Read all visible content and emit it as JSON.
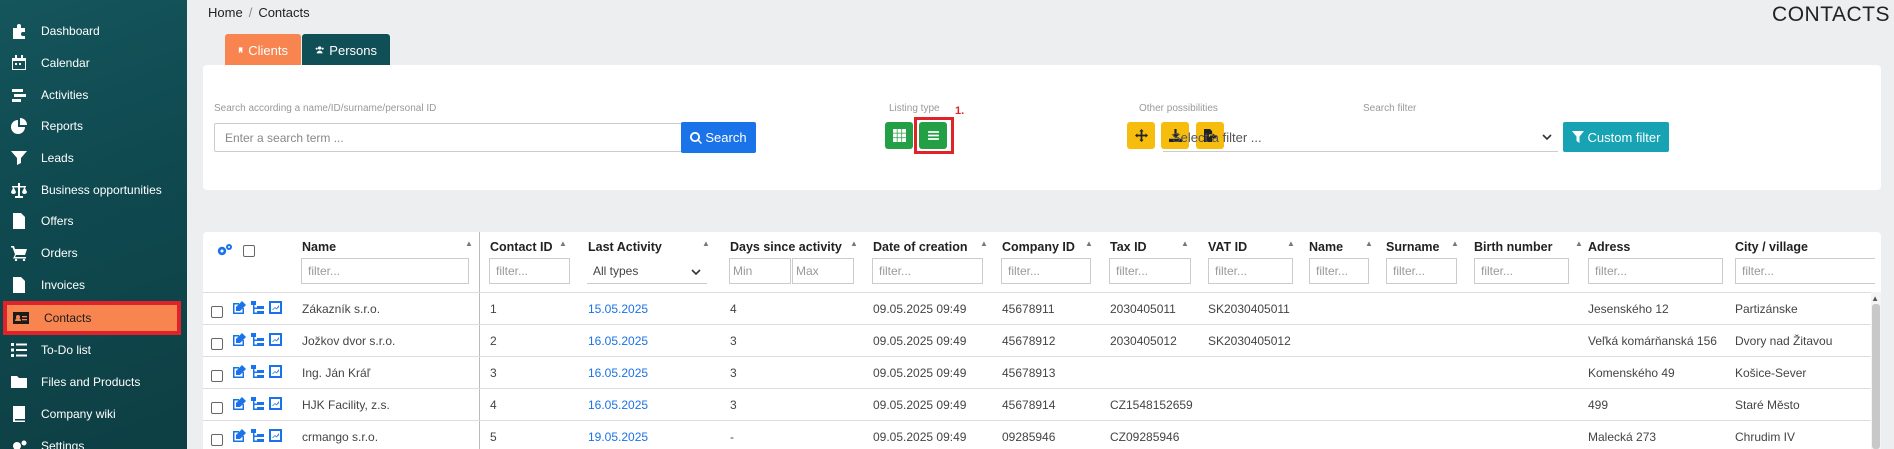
{
  "sidebar": {
    "items": [
      {
        "label": "Dashboard",
        "icon": "puzzle-icon"
      },
      {
        "label": "Calendar",
        "icon": "calendar-icon"
      },
      {
        "label": "Activities",
        "icon": "activities-icon"
      },
      {
        "label": "Reports",
        "icon": "pie-chart-icon"
      },
      {
        "label": "Leads",
        "icon": "leads-icon"
      },
      {
        "label": "Business opportunities",
        "icon": "scale-icon"
      },
      {
        "label": "Offers",
        "icon": "document-icon"
      },
      {
        "label": "Orders",
        "icon": "cart-icon"
      },
      {
        "label": "Invoices",
        "icon": "invoice-icon"
      },
      {
        "label": "Contacts",
        "icon": "contact-card-icon"
      },
      {
        "label": "To-Do list",
        "icon": "list-icon"
      },
      {
        "label": "Files and Products",
        "icon": "folder-icon"
      },
      {
        "label": "Company wiki",
        "icon": "book-icon"
      },
      {
        "label": "Settings",
        "icon": "gears-icon"
      }
    ],
    "active": "Contacts"
  },
  "breadcrumb": {
    "home": "Home",
    "sep": "/",
    "current": "Contacts"
  },
  "page_title": "CONTACTS",
  "tabs": {
    "clients": "Clients",
    "persons": "Persons"
  },
  "search": {
    "label": "Search according a name/ID/surname/personal ID",
    "placeholder": "Enter a search term ...",
    "button": "Search"
  },
  "listing": {
    "label": "Listing type",
    "annotation": "1."
  },
  "other": {
    "label": "Other possibilities"
  },
  "filter": {
    "label": "Search filter",
    "placeholder": "Select a filter ...",
    "custom_button": "Custom filter"
  },
  "table": {
    "columns": {
      "name": "Name",
      "contact_id": "Contact ID",
      "last_activity": "Last Activity",
      "days_since": "Days since activity",
      "date_creation": "Date of creation",
      "company_id": "Company ID",
      "tax_id": "Tax ID",
      "vat_id": "VAT ID",
      "pname": "Name",
      "surname": "Surname",
      "birth_number": "Birth number",
      "adress": "Adress",
      "city": "City / village"
    },
    "filters": {
      "placeholder": "filter...",
      "all_types": "All types",
      "min": "Min",
      "max": "Max"
    },
    "rows": [
      {
        "name": "Zákazník s.r.o.",
        "id": "1",
        "last": "15.05.2025",
        "days": "4",
        "created": "09.05.2025 09:49",
        "company": "45678911",
        "tax": "2030405011",
        "vat": "SK2030405011",
        "adress": "Jesenského 12",
        "city": "Partizánske"
      },
      {
        "name": "Jožkov dvor s.r.o.",
        "id": "2",
        "last": "16.05.2025",
        "days": "3",
        "created": "09.05.2025 09:49",
        "company": "45678912",
        "tax": "2030405012",
        "vat": "SK2030405012",
        "adress": "Veľká komárňanská 156",
        "city": "Dvory nad Žitavou"
      },
      {
        "name": "Ing. Ján Kráľ",
        "id": "3",
        "last": "16.05.2025",
        "days": "3",
        "created": "09.05.2025 09:49",
        "company": "45678913",
        "tax": "",
        "vat": "",
        "adress": "Komenského 49",
        "city": "Košice-Sever"
      },
      {
        "name": "HJK Facility, z.s.",
        "id": "4",
        "last": "16.05.2025",
        "days": "3",
        "created": "09.05.2025 09:49",
        "company": "45678914",
        "tax": "CZ1548152659",
        "vat": "",
        "adress": "499",
        "city": "Staré Město"
      },
      {
        "name": "crmango s.r.o.",
        "id": "5",
        "last": "19.05.2025",
        "days": "-",
        "created": "09.05.2025 09:49",
        "company": "09285946",
        "tax": "CZ09285946",
        "vat": "",
        "adress": "Malecká 273",
        "city": "Chrudim IV"
      }
    ]
  },
  "colors": {
    "sidebar": "#0f4a50",
    "accent_orange": "#f8844f",
    "highlight_red": "#e0232b",
    "link_blue": "#1a73e8",
    "green": "#23a046",
    "yellow": "#f6bc0e",
    "teal": "#17a3b4"
  }
}
